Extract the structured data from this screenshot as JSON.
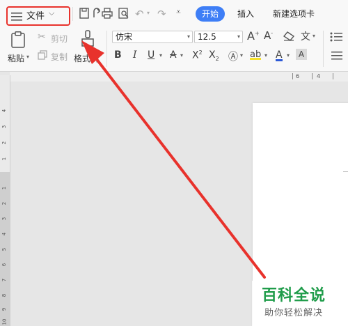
{
  "titlebar": {
    "menu_label": "文件",
    "tabs": [
      {
        "label": "开始",
        "active": true
      },
      {
        "label": "插入",
        "active": false
      },
      {
        "label": "新建选项卡",
        "active": false
      }
    ]
  },
  "clipboard": {
    "paste_label": "粘贴",
    "cut_label": "剪切",
    "copy_label": "复制",
    "format_painter_label": "格式刷"
  },
  "font": {
    "family_value": "仿宋",
    "size_value": "12.5"
  },
  "ruler": {
    "vertical_numbers": [
      "4",
      "3",
      "2",
      "1",
      "1",
      "2",
      "3",
      "4",
      "5",
      "6",
      "7",
      "8",
      "9",
      "10"
    ],
    "horizontal_marks": [
      "6",
      "4"
    ]
  },
  "watermark": {
    "title": "百科全说",
    "subtitle": "助你轻松解决"
  },
  "colors": {
    "accent": "#3e7ef6",
    "highlight_box": "#e8322c",
    "watermark_green": "#1f9c4a"
  }
}
